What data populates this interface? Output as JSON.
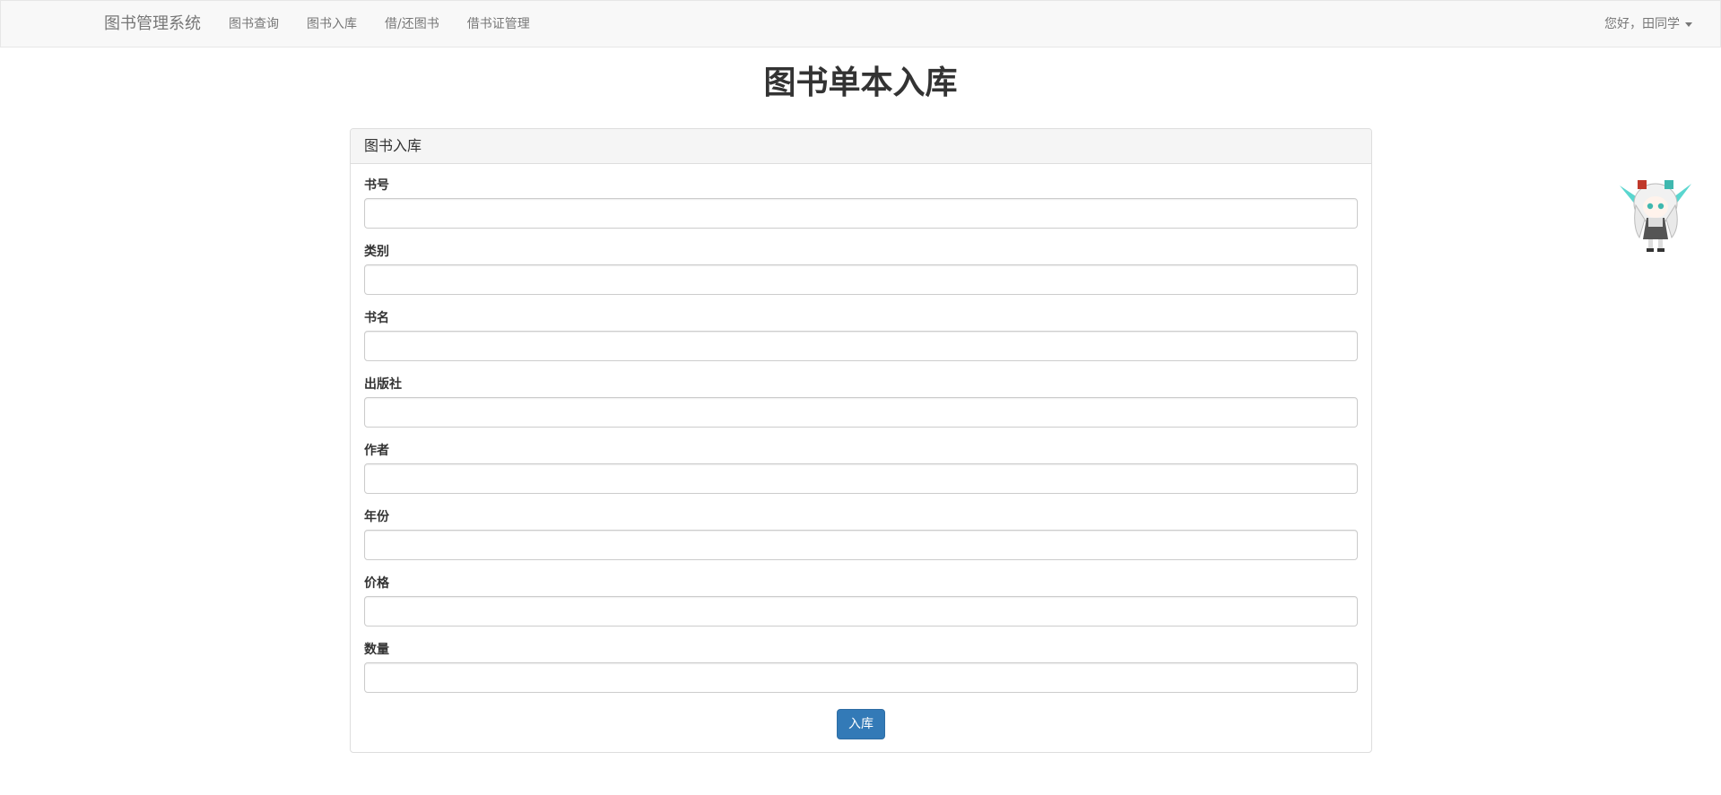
{
  "navbar": {
    "brand": "图书管理系统",
    "links": [
      {
        "label": "图书查询"
      },
      {
        "label": "图书入库"
      },
      {
        "label": "借/还图书"
      },
      {
        "label": "借书证管理"
      }
    ],
    "user_greeting": "您好，田同学"
  },
  "page": {
    "title": "图书单本入库"
  },
  "panel": {
    "heading": "图书入库",
    "fields": [
      {
        "label": "书号",
        "value": ""
      },
      {
        "label": "类别",
        "value": ""
      },
      {
        "label": "书名",
        "value": ""
      },
      {
        "label": "出版社",
        "value": ""
      },
      {
        "label": "作者",
        "value": ""
      },
      {
        "label": "年份",
        "value": ""
      },
      {
        "label": "价格",
        "value": ""
      },
      {
        "label": "数量",
        "value": ""
      }
    ],
    "submit_label": "入库"
  },
  "colors": {
    "navbar_bg": "#f8f8f8",
    "primary": "#337ab7",
    "text": "#333333",
    "muted": "#777777"
  },
  "icons": {
    "mascot": "anime-mascot-widget",
    "user_menu": "caret-down-icon"
  }
}
